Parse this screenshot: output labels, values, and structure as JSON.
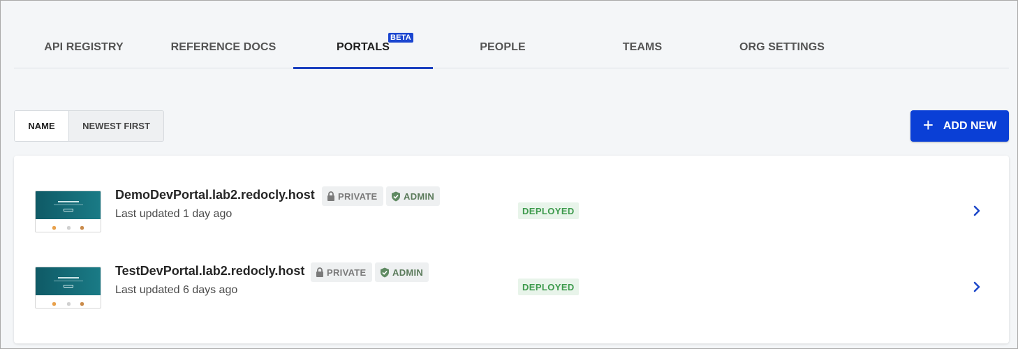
{
  "tabs": [
    {
      "label": "API REGISTRY"
    },
    {
      "label": "REFERENCE DOCS"
    },
    {
      "label": "PORTALS",
      "badge": "BETA",
      "active": true
    },
    {
      "label": "PEOPLE"
    },
    {
      "label": "TEAMS"
    },
    {
      "label": "ORG SETTINGS"
    }
  ],
  "sort": {
    "name_label": "NAME",
    "newest_label": "NEWEST FIRST",
    "selected": "NAME"
  },
  "add_button": {
    "label": "ADD NEW",
    "icon": "plus-icon"
  },
  "portals": [
    {
      "title": "DemoDevPortal.lab2.redocly.host",
      "updated": "Last updated 1 day ago",
      "visibility": "PRIVATE",
      "role": "ADMIN",
      "status": "DEPLOYED"
    },
    {
      "title": "TestDevPortal.lab2.redocly.host",
      "updated": "Last updated 6 days ago",
      "visibility": "PRIVATE",
      "role": "ADMIN",
      "status": "DEPLOYED"
    }
  ],
  "colors": {
    "accent": "#0a3fd6",
    "tab_underline": "#1a3fbf",
    "deployed_text": "#3d9a4c",
    "deployed_bg": "#e8f4ea",
    "page_bg": "#f4f6f8"
  }
}
